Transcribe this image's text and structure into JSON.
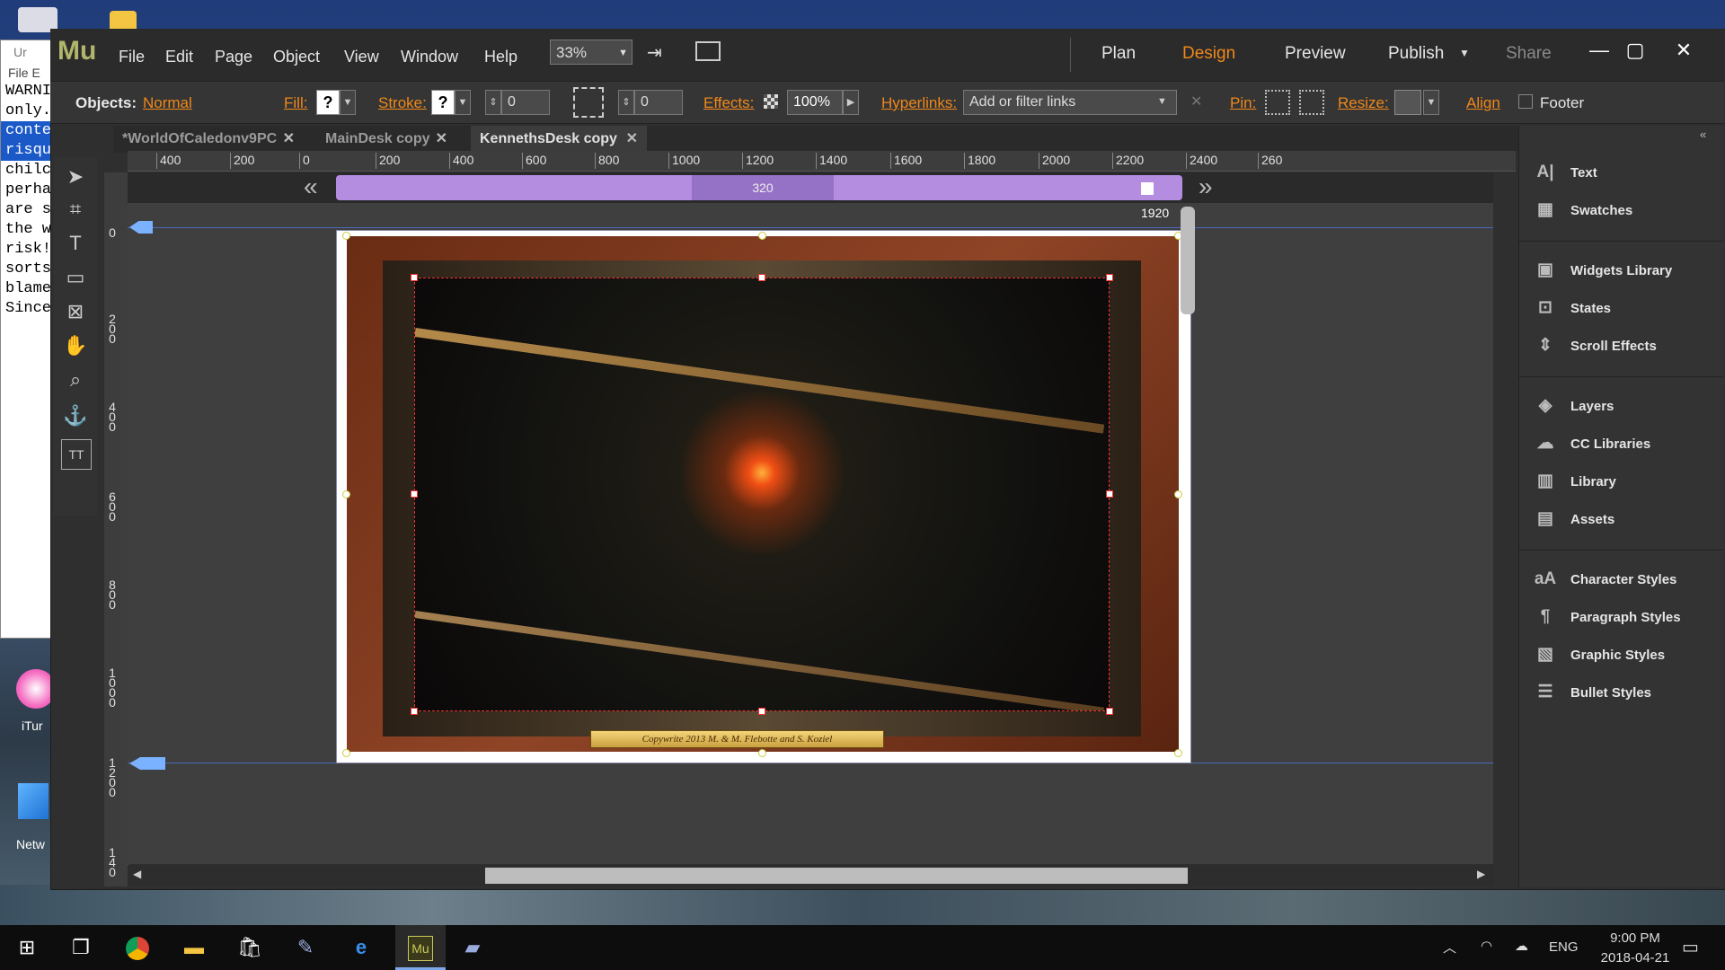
{
  "background_window": {
    "title": "Ur",
    "menu": [
      "File",
      "E"
    ],
    "lines": [
      {
        "text": "WARNI",
        "selected": false
      },
      {
        "text": "only.",
        "selected": false
      },
      {
        "text": "conte",
        "selected": true
      },
      {
        "text": "risqu",
        "selected": true
      },
      {
        "text": "chilc",
        "selected": false
      },
      {
        "text": "perha",
        "selected": false
      },
      {
        "text": "are s",
        "selected": false
      },
      {
        "text": "the w",
        "selected": false
      },
      {
        "text": "risk!",
        "selected": false
      },
      {
        "text": "sorts",
        "selected": false
      },
      {
        "text": "blame",
        "selected": false
      },
      {
        "text": "Since",
        "selected": false
      }
    ]
  },
  "desktop_icons": {
    "itunes": "iTur",
    "network": "Netw"
  },
  "app": {
    "logo": "Mu",
    "menu": [
      "File",
      "Edit",
      "Page",
      "Object",
      "View",
      "Window",
      "Help"
    ],
    "zoom": "33%",
    "modes": {
      "plan": "Plan",
      "design": "Design",
      "preview": "Preview",
      "publish": "Publish",
      "share": "Share"
    },
    "window_controls": {
      "minimize": "—",
      "maximize": "▢",
      "close": "✕"
    }
  },
  "controlbar": {
    "objects_label": "Objects:",
    "objects_value": "Normal",
    "fill_label": "Fill:",
    "fill_value": "?",
    "stroke_label": "Stroke:",
    "stroke_value": "?",
    "stroke_width": "0",
    "corner_value": "0",
    "effects_label": "Effects:",
    "opacity": "100%",
    "hyperlinks_label": "Hyperlinks:",
    "hyperlinks_placeholder": "Add or filter links",
    "pin_label": "Pin:",
    "resize_label": "Resize:",
    "align_label": "Align",
    "footer_label": "Footer"
  },
  "tabs": [
    {
      "label": "*WorldOfCaledonv9PC",
      "active": false
    },
    {
      "label": "MainDesk copy",
      "active": false
    },
    {
      "label": "KennethsDesk copy",
      "active": true
    }
  ],
  "rulers": {
    "horizontal": [
      "400",
      "200",
      "0",
      "200",
      "400",
      "600",
      "800",
      "1000",
      "1200",
      "1400",
      "1600",
      "1800",
      "2000",
      "2200",
      "2400",
      "260"
    ],
    "vertical": [
      "0",
      "200",
      "400",
      "600",
      "800",
      "1000",
      "1200",
      "140"
    ]
  },
  "breakpoints": {
    "min": "320",
    "max": "1920"
  },
  "artwork": {
    "plaque_text": "Copywrite 2013 M. & M. Flebotte and S. Koziel"
  },
  "panels": [
    {
      "label": "Text",
      "icon": "text-icon",
      "glyph": "A|"
    },
    {
      "label": "Swatches",
      "icon": "swatches-icon",
      "glyph": "▦"
    },
    {
      "label": "Widgets Library",
      "icon": "widgets-icon",
      "glyph": "▣"
    },
    {
      "label": "States",
      "icon": "states-icon",
      "glyph": "⊡"
    },
    {
      "label": "Scroll Effects",
      "icon": "scroll-effects-icon",
      "glyph": "⇕"
    },
    {
      "label": "Layers",
      "icon": "layers-icon",
      "glyph": "◈"
    },
    {
      "label": "CC Libraries",
      "icon": "cc-libraries-icon",
      "glyph": "☁"
    },
    {
      "label": "Library",
      "icon": "library-icon",
      "glyph": "▥"
    },
    {
      "label": "Assets",
      "icon": "assets-icon",
      "glyph": "▤"
    },
    {
      "label": "Character Styles",
      "icon": "character-styles-icon",
      "glyph": "aA"
    },
    {
      "label": "Paragraph Styles",
      "icon": "paragraph-styles-icon",
      "glyph": "¶"
    },
    {
      "label": "Graphic Styles",
      "icon": "graphic-styles-icon",
      "glyph": "▧"
    },
    {
      "label": "Bullet Styles",
      "icon": "bullet-styles-icon",
      "glyph": "☰"
    }
  ],
  "taskbar": {
    "language": "ENG",
    "time": "9:00 PM",
    "date": "2018-04-21"
  },
  "colors": {
    "accent": "#f0881a",
    "breakpoint": "#b48de0",
    "selection": "#1b59c9"
  }
}
